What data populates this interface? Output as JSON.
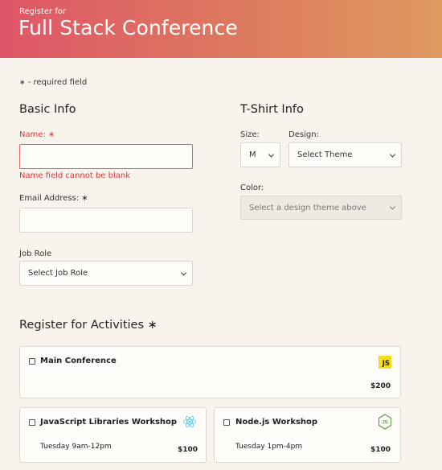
{
  "header": {
    "pre_title": "Register for",
    "title": "Full Stack Conference"
  },
  "required_note": {
    "star": "∗",
    "text": " - required field"
  },
  "basic_info": {
    "heading": "Basic Info",
    "name_label": "Name: ∗",
    "name_value": "",
    "name_error": "Name field cannot be blank",
    "email_label": "Email Address: ∗",
    "email_value": "",
    "job_role_label": "Job Role",
    "job_role_selected": "Select Job Role"
  },
  "tshirt_info": {
    "heading": "T-Shirt Info",
    "size_label": "Size:",
    "size_selected": "M",
    "design_label": "Design:",
    "design_selected": "Select Theme",
    "color_label": "Color:",
    "color_selected": "Select a design theme above"
  },
  "activities": {
    "heading": "Register for Activities ∗",
    "items": [
      {
        "name": "Main Conference",
        "time": "",
        "price": "$200",
        "icon": "js-icon",
        "icon_text": "JS"
      },
      {
        "name": "JavaScript Libraries Workshop",
        "time": "Tuesday 9am-12pm",
        "price": "$100",
        "icon": "react-icon"
      },
      {
        "name": "Node.js Workshop",
        "time": "Tuesday 1pm-4pm",
        "price": "$100",
        "icon": "nodejs-icon"
      }
    ]
  },
  "colors": {
    "header_gradient_start": "#de5668",
    "header_gradient_end": "#df9a60",
    "error": "#d33d3a",
    "background": "#f8f3ec",
    "react": "#5ccfee",
    "node": "#5a9e4b"
  }
}
